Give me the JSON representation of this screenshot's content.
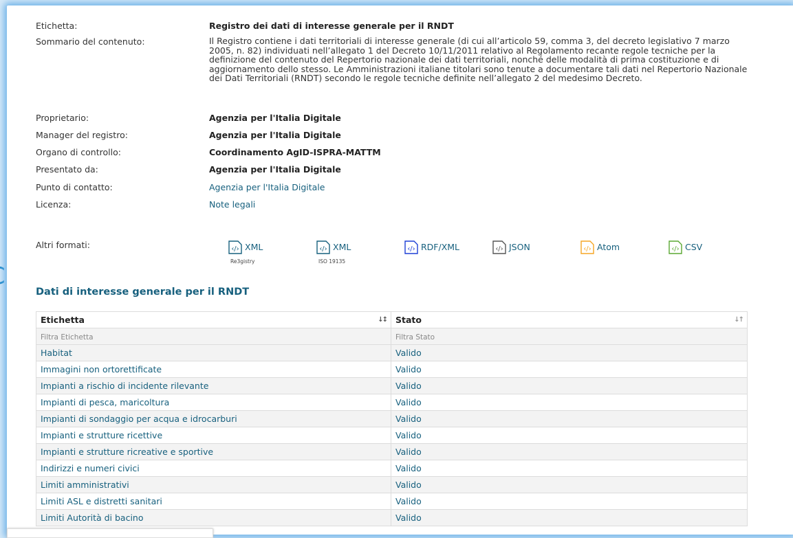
{
  "details": {
    "etichetta": {
      "label": "Etichetta:",
      "value": "Registro dei dati di interesse generale per il RNDT"
    },
    "sommario": {
      "label": "Sommario del contenuto:",
      "value": "Il Registro contiene i dati territoriali di interesse generale (di cui all’articolo 59, comma 3, del decreto legislativo 7 marzo 2005, n. 82) individuati nell’allegato 1 del Decreto 10/11/2011 relativo al Regolamento recante regole tecniche per la definizione del contenuto del Repertorio nazionale dei dati territoriali, nonché delle modalità di prima costituzione e di aggiornamento dello stesso. Le Amministrazioni italiane titolari sono tenute a documentare tali dati nel Repertorio Nazionale dei Dati Territoriali (RNDT) secondo le regole tecniche definite nell’allegato 2 del medesimo Decreto."
    },
    "proprietario": {
      "label": "Proprietario:",
      "value": "Agenzia per l'Italia Digitale"
    },
    "manager": {
      "label": "Manager del registro:",
      "value": "Agenzia per l'Italia Digitale"
    },
    "organo": {
      "label": "Organo di controllo:",
      "value": "Coordinamento AgID-ISPRA-MATTM"
    },
    "presentato": {
      "label": "Presentato da:",
      "value": "Agenzia per l'Italia Digitale"
    },
    "contatto": {
      "label": "Punto di contatto:",
      "value": "Agenzia per l'Italia Digitale"
    },
    "licenza": {
      "label": "Licenza:",
      "value": "Note legali"
    },
    "formati": {
      "label": "Altri formati:"
    }
  },
  "formats": [
    {
      "label": "XML",
      "sub": "Re3gistry",
      "color": "#17607e"
    },
    {
      "label": "XML",
      "sub": "ISO 19135",
      "color": "#17607e"
    },
    {
      "label": "RDF/XML",
      "sub": "",
      "color": "#1d3fd6"
    },
    {
      "label": "JSON",
      "sub": "",
      "color": "#555555"
    },
    {
      "label": "Atom",
      "sub": "",
      "color": "#f5a623"
    },
    {
      "label": "CSV",
      "sub": "",
      "color": "#5aa832"
    }
  ],
  "table": {
    "title": "Dati di interesse generale per il RNDT",
    "filter_label_placeholder": "Filtra Etichetta",
    "filter_status_placeholder": "Filtra Stato",
    "col_label": "Etichetta",
    "col_status": "Stato",
    "rows": [
      {
        "label": "Habitat",
        "status": "Valido"
      },
      {
        "label": "Immagini non ortorettificate",
        "status": "Valido"
      },
      {
        "label": "Impianti a rischio di incidente rilevante",
        "status": "Valido"
      },
      {
        "label": "Impianti di pesca, maricoltura",
        "status": "Valido"
      },
      {
        "label": "Impianti di sondaggio per acqua e idrocarburi",
        "status": "Valido"
      },
      {
        "label": "Impianti e strutture ricettive",
        "status": "Valido"
      },
      {
        "label": "Impianti e strutture ricreative e sportive",
        "status": "Valido"
      },
      {
        "label": "Indirizzi e numeri civici",
        "status": "Valido"
      },
      {
        "label": "Limiti amministrativi",
        "status": "Valido"
      },
      {
        "label": "Limiti ASL e distretti sanitari",
        "status": "Valido"
      },
      {
        "label": "Limiti Autorità di bacino",
        "status": "Valido"
      }
    ]
  },
  "colors": {
    "link": "#17607e",
    "accent_glow": "#6fb3e8"
  }
}
